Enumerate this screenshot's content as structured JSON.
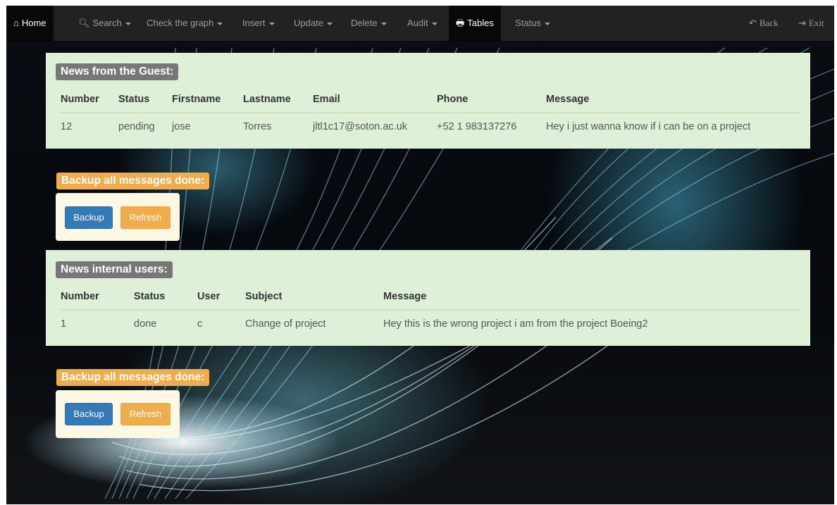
{
  "navbar": {
    "home": "Home",
    "search": "Search",
    "check_graph": "Check the graph",
    "insert": "Insert",
    "update": "Update",
    "delete": "Delete",
    "audit": "Audit",
    "tables": "Tables",
    "status": "Status",
    "back": "Back",
    "exit": "Exit"
  },
  "guest_panel": {
    "title": "News from the Guest:",
    "columns": [
      "Number",
      "Status",
      "Firstname",
      "Lastname",
      "Email",
      "Phone",
      "Message"
    ],
    "rows": [
      [
        "12",
        "pending",
        "jose",
        "Torres",
        "jltl1c17@soton.ac.uk",
        "+52 1 983137276",
        "Hey i just wanna know if i can be on a project"
      ]
    ]
  },
  "backup_guest": {
    "title": "Backup all messages done:",
    "backup_label": "Backup",
    "refresh_label": "Refresh"
  },
  "internal_panel": {
    "title": "News internal users:",
    "columns": [
      "Number",
      "Status",
      "User",
      "Subject",
      "Message"
    ],
    "rows": [
      [
        "1",
        "done",
        "c",
        "Change of project",
        "Hey this is the wrong project i am from the project Boeing2"
      ]
    ]
  },
  "backup_internal": {
    "title": "Backup all messages done:",
    "backup_label": "Backup",
    "refresh_label": "Refresh"
  },
  "icons": {
    "home": "home-icon",
    "search": "search-icon",
    "tables": "print-icon",
    "back": "log-out-icon",
    "exit": "log-in-icon"
  },
  "colors": {
    "navbar": "#222222",
    "panel": "#dff0d8",
    "label_default": "#777777",
    "label_warning": "#f0ad4e",
    "btn_primary": "#337ab7",
    "btn_warning": "#f0ad4e",
    "btn_box": "#fcf8e3"
  }
}
